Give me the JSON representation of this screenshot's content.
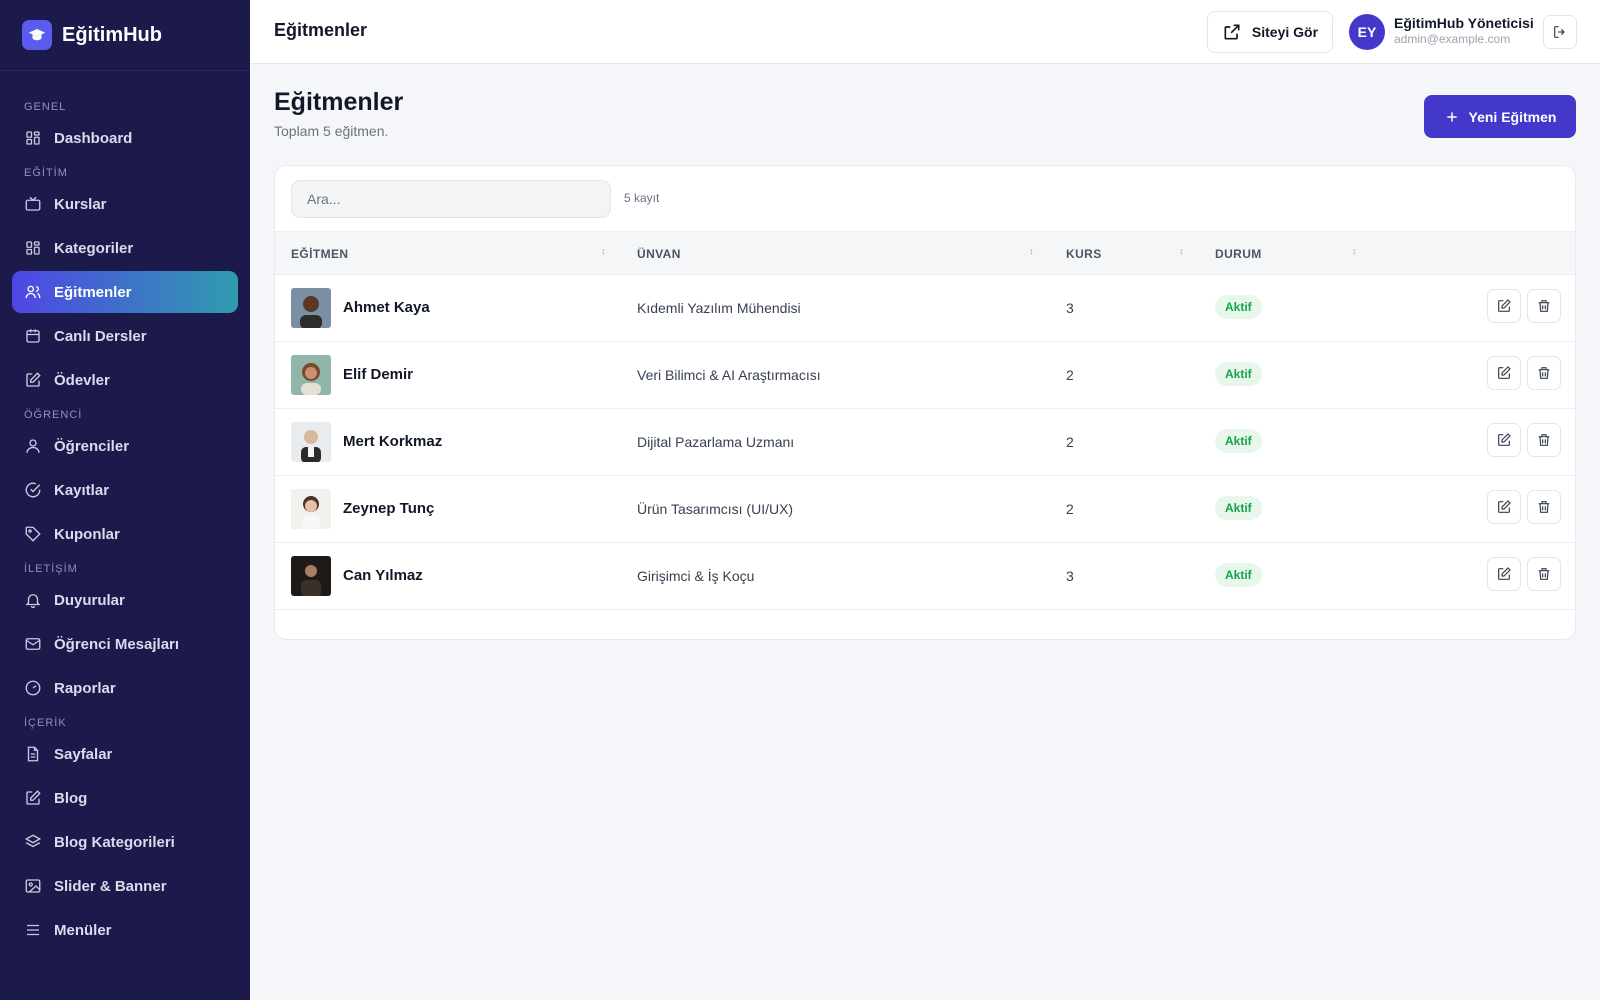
{
  "brand": {
    "name": "EğitimHub"
  },
  "sidebar": {
    "sections": [
      {
        "label": "GENEL",
        "items": [
          {
            "label": "Dashboard",
            "icon": "grid-icon"
          }
        ]
      },
      {
        "label": "EĞİTİM",
        "items": [
          {
            "label": "Kurslar",
            "icon": "tv-icon"
          },
          {
            "label": "Kategoriler",
            "icon": "grid-icon"
          },
          {
            "label": "Eğitmenler",
            "icon": "users-icon",
            "active": true
          },
          {
            "label": "Canlı Dersler",
            "icon": "calendar-icon"
          },
          {
            "label": "Ödevler",
            "icon": "edit-icon"
          }
        ]
      },
      {
        "label": "ÖĞRENCİ",
        "items": [
          {
            "label": "Öğrenciler",
            "icon": "user-icon"
          },
          {
            "label": "Kayıtlar",
            "icon": "check-circle-icon"
          },
          {
            "label": "Kuponlar",
            "icon": "tag-icon"
          }
        ]
      },
      {
        "label": "İLETİŞİM",
        "items": [
          {
            "label": "Duyurular",
            "icon": "bell-icon"
          },
          {
            "label": "Öğrenci Mesajları",
            "icon": "mail-icon"
          },
          {
            "label": "Raporlar",
            "icon": "gauge-icon"
          }
        ]
      },
      {
        "label": "İÇERİK",
        "items": [
          {
            "label": "Sayfalar",
            "icon": "file-icon"
          },
          {
            "label": "Blog",
            "icon": "edit-icon"
          },
          {
            "label": "Blog Kategorileri",
            "icon": "layers-icon"
          },
          {
            "label": "Slider & Banner",
            "icon": "image-icon"
          },
          {
            "label": "Menüler",
            "icon": "menu-icon"
          }
        ]
      }
    ]
  },
  "topbar": {
    "title": "Eğitmenler",
    "site_button": "Siteyi Gör",
    "avatar_initials": "EY",
    "user_name": "EğitimHub Yöneticisi",
    "user_email": "admin@example.com"
  },
  "page": {
    "title": "Eğitmenler",
    "subtitle": "Toplam 5 eğitmen.",
    "new_button": "Yeni Eğitmen"
  },
  "table": {
    "search_placeholder": "Ara...",
    "count_text": "5 kayıt",
    "columns": [
      "EĞİTMEN",
      "ÜNVAN",
      "KURS",
      "DURUM"
    ],
    "rows": [
      {
        "name": "Ahmet Kaya",
        "title": "Kıdemli Yazılım Mühendisi",
        "courses": "3",
        "status": "Aktif"
      },
      {
        "name": "Elif Demir",
        "title": "Veri Bilimci & AI Araştırmacısı",
        "courses": "2",
        "status": "Aktif"
      },
      {
        "name": "Mert Korkmaz",
        "title": "Dijital Pazarlama Uzmanı",
        "courses": "2",
        "status": "Aktif"
      },
      {
        "name": "Zeynep Tunç",
        "title": "Ürün Tasarımcısı (UI/UX)",
        "courses": "2",
        "status": "Aktif"
      },
      {
        "name": "Can Yılmaz",
        "title": "Girişimci & İş Koçu",
        "courses": "3",
        "status": "Aktif"
      }
    ]
  },
  "colors": {
    "sidebar_bg": "#1b1a4a",
    "accent": "#4338ca",
    "active_gradient_end": "#2f9cae",
    "status_green": "#16a34a"
  }
}
